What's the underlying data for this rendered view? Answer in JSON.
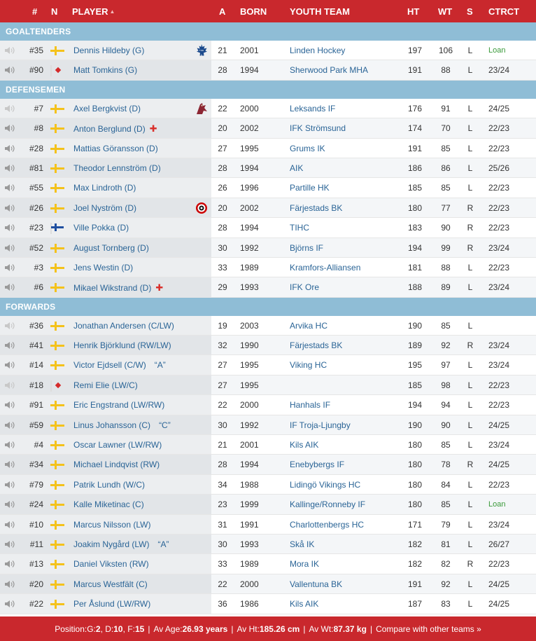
{
  "header": {
    "num": "#",
    "nat": "N",
    "player": "PLAYER",
    "sort_arrow": "▲",
    "age": "A",
    "born": "BORN",
    "youth": "YOUTH TEAM",
    "ht": "HT",
    "wt": "WT",
    "s": "S",
    "contract": "CTRCT"
  },
  "sections": [
    {
      "title": "GOALTENDERS",
      "players": [
        {
          "num": "#35",
          "flag": "se",
          "name": "Dennis Hildeby (G)",
          "team_icon": "maple-leafs-logo-icon",
          "age": "21",
          "born": "2001",
          "youth": "Linden Hockey",
          "ht": "197",
          "wt": "106",
          "s": "L",
          "contract": "Loan",
          "loan": true,
          "speaker": "light"
        },
        {
          "num": "#90",
          "flag": "ca",
          "name": "Matt Tomkins (G)",
          "age": "28",
          "born": "1994",
          "youth": "Sherwood Park MHA",
          "ht": "191",
          "wt": "88",
          "s": "L",
          "contract": "23/24",
          "speaker": "dark"
        }
      ]
    },
    {
      "title": "DEFENSEMEN",
      "players": [
        {
          "num": "#7",
          "flag": "se",
          "name": "Axel Bergkvist (D)",
          "team_icon": "coyotes-logo-icon",
          "age": "22",
          "born": "2000",
          "youth": "Leksands IF",
          "ht": "176",
          "wt": "91",
          "s": "L",
          "contract": "24/25",
          "speaker": "light"
        },
        {
          "num": "#8",
          "flag": "se",
          "name": "Anton Berglund (D)",
          "injured": true,
          "age": "20",
          "born": "2002",
          "youth": "IFK Strömsund",
          "ht": "174",
          "wt": "70",
          "s": "L",
          "contract": "22/23",
          "speaker": "dark"
        },
        {
          "num": "#28",
          "flag": "se",
          "name": "Mattias Göransson (D)",
          "age": "27",
          "born": "1995",
          "youth": "Grums IK",
          "ht": "191",
          "wt": "85",
          "s": "L",
          "contract": "22/23",
          "speaker": "dark"
        },
        {
          "num": "#81",
          "flag": "se",
          "name": "Theodor Lennström (D)",
          "age": "28",
          "born": "1994",
          "youth": "AIK",
          "ht": "186",
          "wt": "86",
          "s": "L",
          "contract": "25/26",
          "speaker": "dark"
        },
        {
          "num": "#55",
          "flag": "se",
          "name": "Max Lindroth (D)",
          "age": "26",
          "born": "1996",
          "youth": "Partille HK",
          "ht": "185",
          "wt": "85",
          "s": "L",
          "contract": "22/23",
          "speaker": "dark"
        },
        {
          "num": "#26",
          "flag": "se",
          "name": "Joel Nyström (D)",
          "team_icon": "hurricanes-logo-icon",
          "age": "20",
          "born": "2002",
          "youth": "Färjestads BK",
          "ht": "180",
          "wt": "77",
          "s": "R",
          "contract": "22/23",
          "speaker": "dark"
        },
        {
          "num": "#23",
          "flag": "fi",
          "name": "Ville Pokka (D)",
          "age": "28",
          "born": "1994",
          "youth": "TIHC",
          "ht": "183",
          "wt": "90",
          "s": "R",
          "contract": "22/23",
          "speaker": "dark"
        },
        {
          "num": "#52",
          "flag": "se",
          "name": "August Tornberg (D)",
          "age": "30",
          "born": "1992",
          "youth": "Björns IF",
          "ht": "194",
          "wt": "99",
          "s": "R",
          "contract": "23/24",
          "speaker": "dark"
        },
        {
          "num": "#3",
          "flag": "se",
          "name": "Jens Westin (D)",
          "age": "33",
          "born": "1989",
          "youth": "Kramfors-Alliansen",
          "ht": "181",
          "wt": "88",
          "s": "L",
          "contract": "22/23",
          "speaker": "dark"
        },
        {
          "num": "#6",
          "flag": "se",
          "name": "Mikael Wikstrand (D)",
          "injured": true,
          "age": "29",
          "born": "1993",
          "youth": "IFK Ore",
          "ht": "188",
          "wt": "89",
          "s": "L",
          "contract": "23/24",
          "speaker": "dark"
        }
      ]
    },
    {
      "title": "FORWARDS",
      "players": [
        {
          "num": "#36",
          "flag": "se",
          "name": "Jonathan Andersen (C/LW)",
          "age": "19",
          "born": "2003",
          "youth": "Arvika HC",
          "ht": "190",
          "wt": "85",
          "s": "L",
          "contract": "",
          "speaker": "light"
        },
        {
          "num": "#41",
          "flag": "se",
          "name": "Henrik Björklund (RW/LW)",
          "age": "32",
          "born": "1990",
          "youth": "Färjestads BK",
          "ht": "189",
          "wt": "92",
          "s": "R",
          "contract": "23/24",
          "speaker": "dark"
        },
        {
          "num": "#14",
          "flag": "se",
          "name": "Victor Ejdsell (C/W)",
          "captain": "“A”",
          "age": "27",
          "born": "1995",
          "youth": "Viking HC",
          "ht": "195",
          "wt": "97",
          "s": "L",
          "contract": "23/24",
          "speaker": "dark"
        },
        {
          "num": "#18",
          "flag": "ca",
          "name": "Remi Elie (LW/C)",
          "age": "27",
          "born": "1995",
          "youth": "",
          "ht": "185",
          "wt": "98",
          "s": "L",
          "contract": "22/23",
          "speaker": "light"
        },
        {
          "num": "#91",
          "flag": "se",
          "name": "Eric Engstrand (LW/RW)",
          "age": "22",
          "born": "2000",
          "youth": "Hanhals IF",
          "ht": "194",
          "wt": "94",
          "s": "L",
          "contract": "22/23",
          "speaker": "dark"
        },
        {
          "num": "#59",
          "flag": "se",
          "name": "Linus Johansson (C)",
          "captain": "“C”",
          "age": "30",
          "born": "1992",
          "youth": "IF Troja-Ljungby",
          "ht": "190",
          "wt": "90",
          "s": "L",
          "contract": "24/25",
          "speaker": "dark"
        },
        {
          "num": "#4",
          "flag": "se",
          "name": "Oscar Lawner (LW/RW)",
          "age": "21",
          "born": "2001",
          "youth": "Kils AIK",
          "ht": "180",
          "wt": "85",
          "s": "L",
          "contract": "23/24",
          "speaker": "dark"
        },
        {
          "num": "#34",
          "flag": "se",
          "name": "Michael Lindqvist (RW)",
          "age": "28",
          "born": "1994",
          "youth": "Enebybergs IF",
          "ht": "180",
          "wt": "78",
          "s": "R",
          "contract": "24/25",
          "speaker": "dark"
        },
        {
          "num": "#79",
          "flag": "se",
          "name": "Patrik Lundh (W/C)",
          "age": "34",
          "born": "1988",
          "youth": "Lidingö Vikings HC",
          "ht": "180",
          "wt": "84",
          "s": "L",
          "contract": "22/23",
          "speaker": "dark"
        },
        {
          "num": "#24",
          "flag": "se",
          "name": "Kalle Miketinac (C)",
          "age": "23",
          "born": "1999",
          "youth": "Kallinge/Ronneby IF",
          "ht": "180",
          "wt": "85",
          "s": "L",
          "contract": "Loan",
          "loan": true,
          "speaker": "dark"
        },
        {
          "num": "#10",
          "flag": "se",
          "name": "Marcus Nilsson (LW)",
          "age": "31",
          "born": "1991",
          "youth": "Charlottenbergs HC",
          "ht": "171",
          "wt": "79",
          "s": "L",
          "contract": "23/24",
          "speaker": "dark"
        },
        {
          "num": "#11",
          "flag": "se",
          "name": "Joakim Nygård (LW)",
          "captain": "“A”",
          "age": "30",
          "born": "1993",
          "youth": "Skå IK",
          "ht": "182",
          "wt": "81",
          "s": "L",
          "contract": "26/27",
          "speaker": "dark"
        },
        {
          "num": "#13",
          "flag": "se",
          "name": "Daniel Viksten (RW)",
          "age": "33",
          "born": "1989",
          "youth": "Mora IK",
          "ht": "182",
          "wt": "82",
          "s": "R",
          "contract": "22/23",
          "speaker": "dark"
        },
        {
          "num": "#20",
          "flag": "se",
          "name": "Marcus Westfält (C)",
          "age": "22",
          "born": "2000",
          "youth": "Vallentuna BK",
          "ht": "191",
          "wt": "92",
          "s": "L",
          "contract": "24/25",
          "speaker": "dark"
        },
        {
          "num": "#22",
          "flag": "se",
          "name": "Per Åslund (LW/RW)",
          "age": "36",
          "born": "1986",
          "youth": "Kils AIK",
          "ht": "187",
          "wt": "83",
          "s": "L",
          "contract": "24/25",
          "speaker": "dark"
        }
      ]
    }
  ],
  "footer": {
    "pos_label": "Position: ",
    "g_label": "G: ",
    "g": "2",
    "d_label": ", D: ",
    "d": "10",
    "f_label": ", F: ",
    "f": "15",
    "sep": "|",
    "age_label": "Av Age: ",
    "age": "26.93 years",
    "ht_label": "Av Ht: ",
    "ht": "185.26 cm",
    "wt_label": "Av Wt: ",
    "wt": "87.37 kg",
    "compare": "Compare with other teams »"
  }
}
